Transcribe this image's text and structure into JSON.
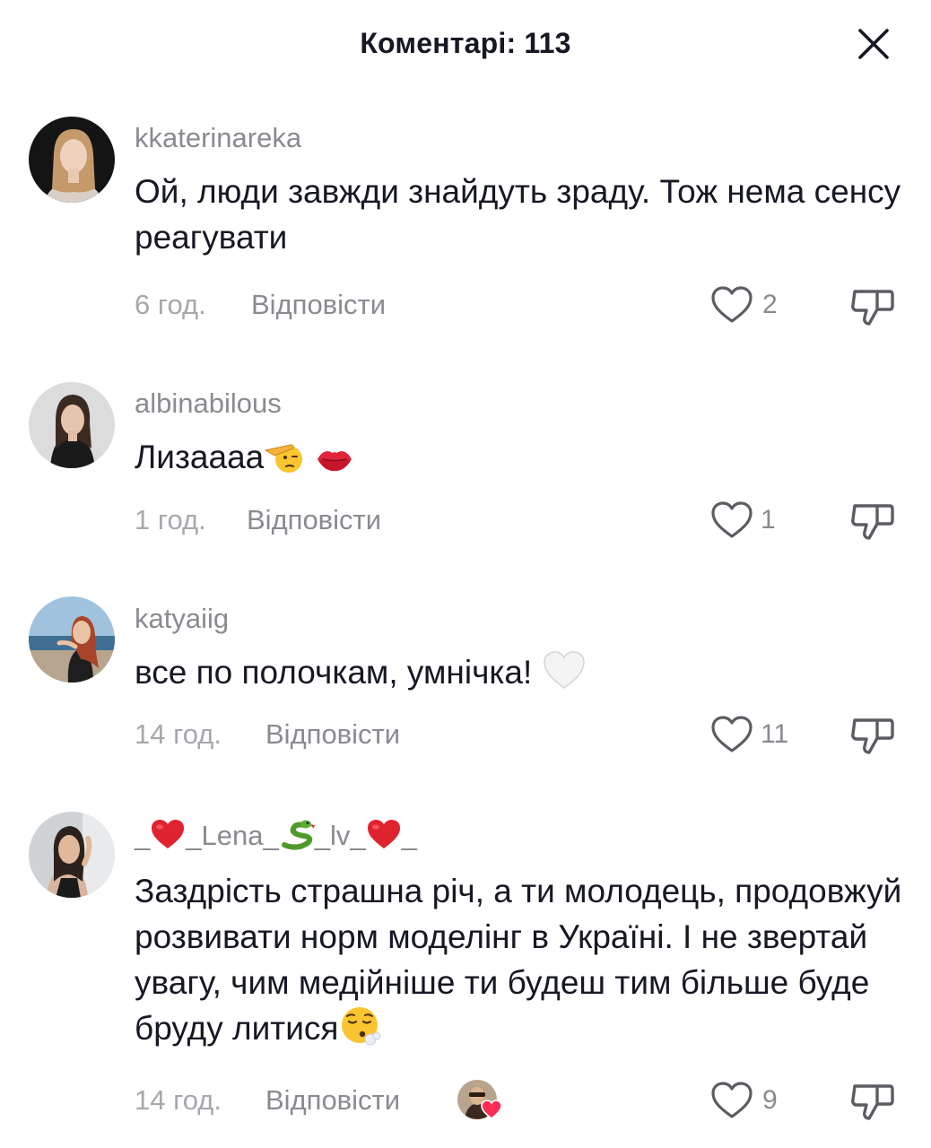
{
  "header": {
    "title": "Коментарі: 113"
  },
  "comments": [
    {
      "username": "kkaterinareka",
      "text": "Ой, люди завжди знайдуть зраду. Тож нема сенсу реагувати",
      "time": "6 год.",
      "reply_label": "Відповісти",
      "likes": "2"
    },
    {
      "username": "albinabilous",
      "text": "Лизаааа",
      "emojis": [
        "saluting-face",
        "kiss-mark"
      ],
      "time": "1 год.",
      "reply_label": "Відповісти",
      "likes": "1"
    },
    {
      "username": "katyaiig",
      "text": "все по полочкам, умнічка!",
      "emojis": [
        "white-heart"
      ],
      "time": "14 год.",
      "reply_label": "Відповісти",
      "likes": "11"
    },
    {
      "username_parts": [
        "_",
        "_Lena_",
        "_lv_",
        "_"
      ],
      "username_icons": [
        "red-heart",
        "snake",
        "red-heart"
      ],
      "text": "Заздрість страшна річ, а ти молодець, продовжуй розвивати норм моделінг в Україні. І не звертай увагу, чим медійніше ти будеш тим більше буде бруду литися",
      "emojis": [
        "face-exhaling"
      ],
      "time": "14 год.",
      "reply_label": "Відповісти",
      "likes": "9",
      "liked_by_creator": true
    }
  ],
  "colors": {
    "text": "#161823",
    "secondary": "#8a8b91",
    "time": "#a7a8ad",
    "heart_red": "#e0242f"
  }
}
